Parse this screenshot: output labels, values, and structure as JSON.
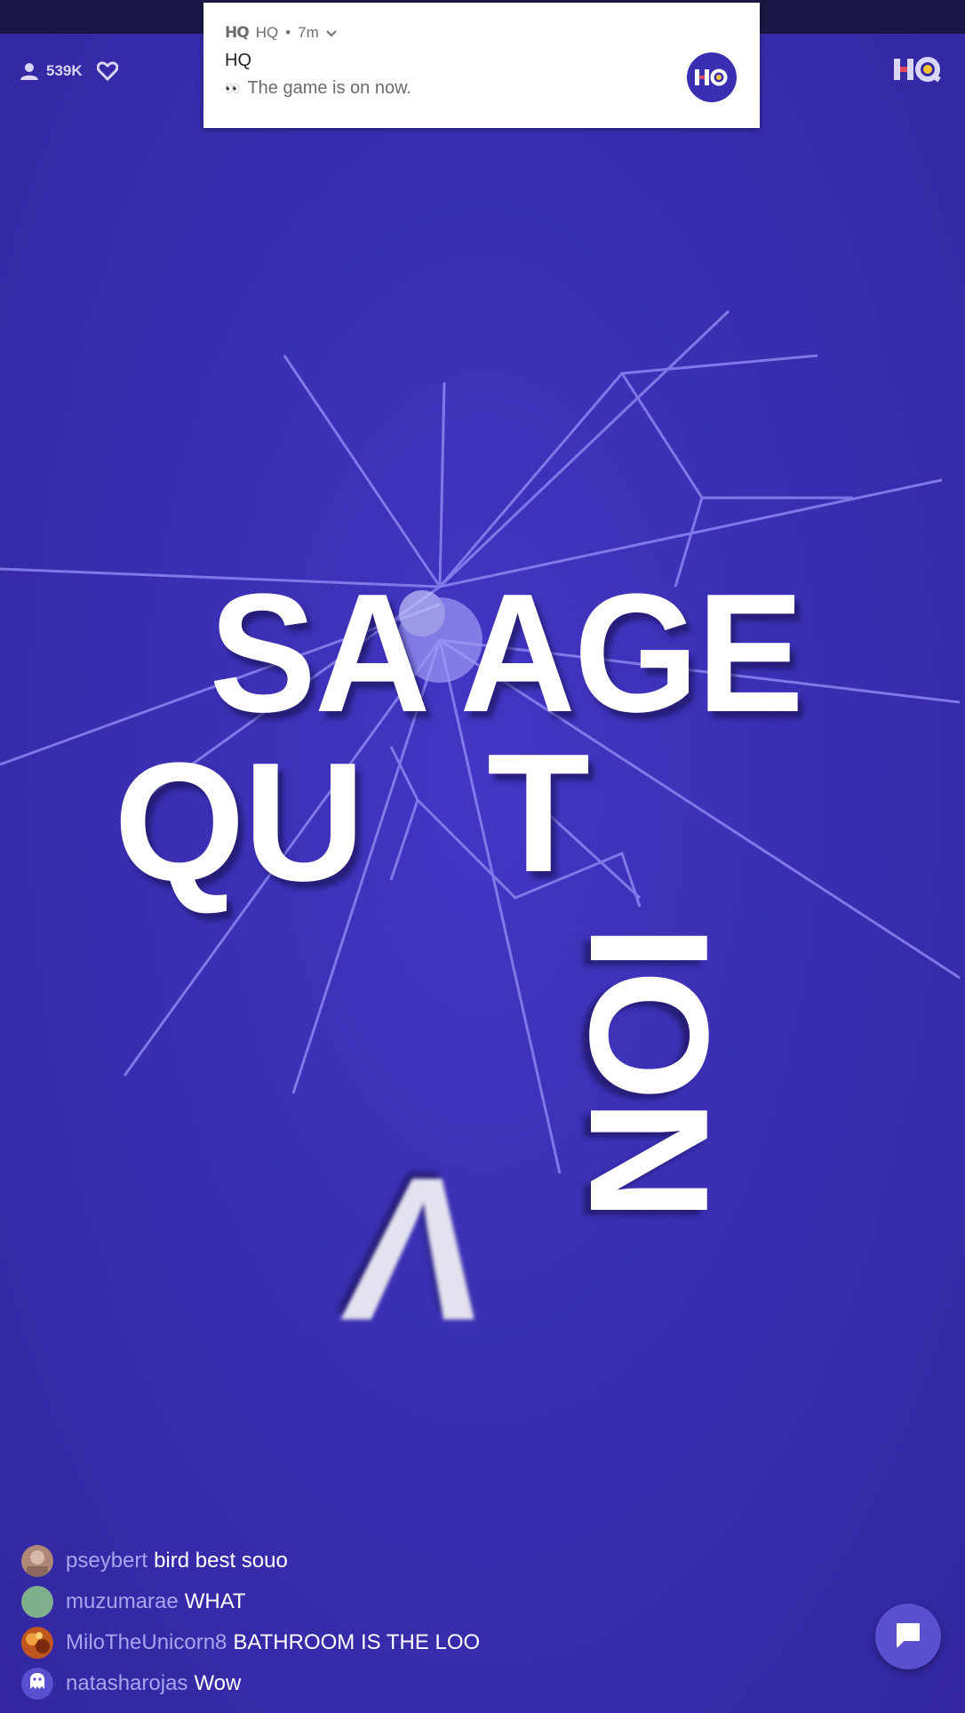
{
  "top_bar": {
    "viewer_count": "539K",
    "viewer_icon": "person-icon",
    "heart_icon": "heart-icon",
    "logo": "HQ"
  },
  "notification": {
    "app_icon": "HQ",
    "app_name": "HQ",
    "time": "7m",
    "separator": "•",
    "title": "HQ",
    "eyes": "👀",
    "body": "The game is on now.",
    "avatar_logo": "HQ"
  },
  "art": {
    "line1": "SA AGE",
    "line2_left": "QU",
    "line2_mid": "T",
    "line3_rotated": "ION",
    "falling_letter": "V"
  },
  "chat": [
    {
      "user": "pseybert",
      "message": "bird best souo",
      "avatar_color": "#b08878"
    },
    {
      "user": "muzumarae",
      "message": "WHAT",
      "avatar_color": "#7fb08e"
    },
    {
      "user": "MiloTheUnicorn8",
      "message": "BATHROOM IS THE LOO",
      "avatar_color": "#c0561f"
    },
    {
      "user": "natasharojas",
      "message": "Wow",
      "avatar_color": "#5a4fcf"
    }
  ],
  "colors": {
    "background": "#3a30a8",
    "accent": "#5a4fcf",
    "username": "#a9a3f0"
  }
}
